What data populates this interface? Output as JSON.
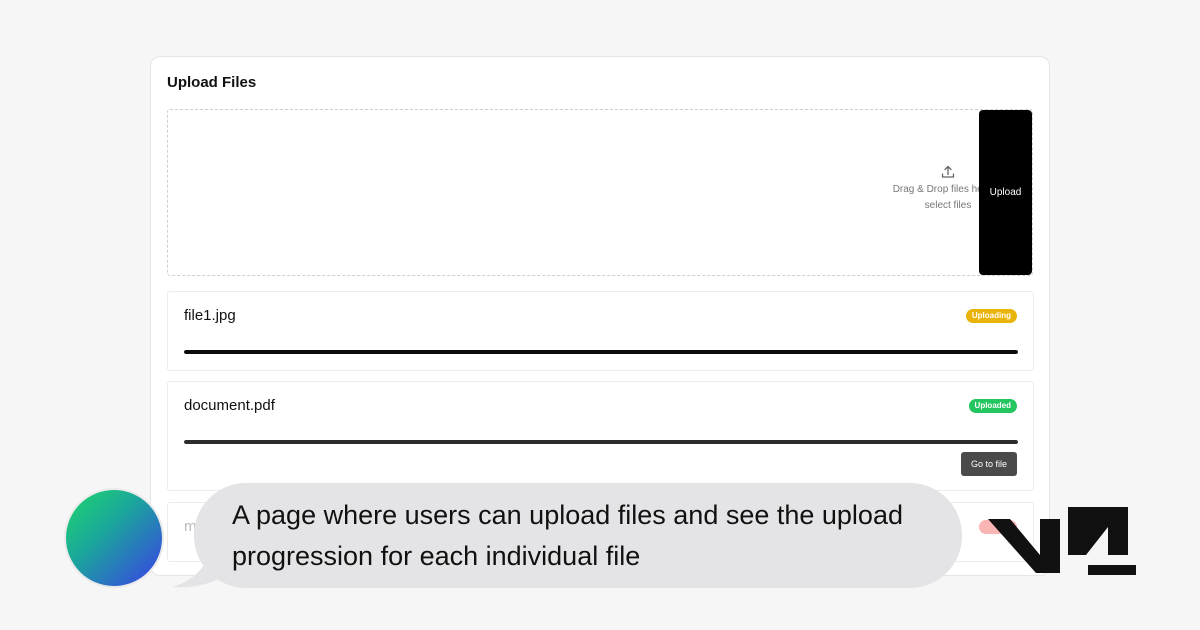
{
  "card": {
    "title": "Upload Files"
  },
  "dropzone": {
    "icon": "upload-icon",
    "text_line1": "Drag & Drop files here or",
    "text_line2": "select files",
    "upload_button": "Upload"
  },
  "files": [
    {
      "name": "file1.jpg",
      "status": "Uploading",
      "status_color": "#eab308",
      "progress": 1.0
    },
    {
      "name": "document.pdf",
      "status": "Uploaded",
      "status_color": "#22c55e",
      "progress": 1.0,
      "action": "Go to file"
    },
    {
      "name": "m",
      "status_color": "#ef4444"
    }
  ],
  "chat": {
    "message": "A page where users can upload files and see the upload progression for each individual file"
  },
  "colors": {
    "page_bg": "#f6f6f6",
    "accent": "#000000",
    "bubble_bg": "#e4e4e6"
  }
}
